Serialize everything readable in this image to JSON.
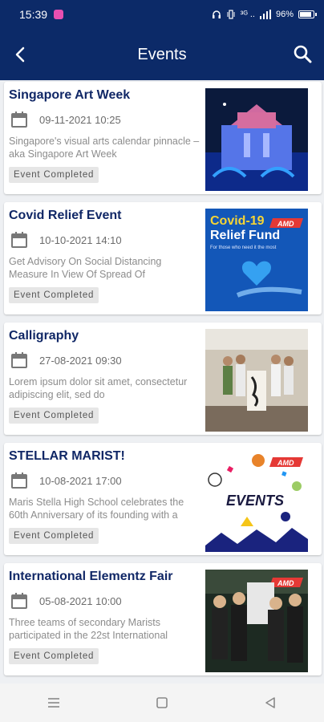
{
  "status_bar": {
    "time": "15:39",
    "network": "³ᴳ ..",
    "battery": "96%",
    "battery_level": 0.96
  },
  "header": {
    "title": "Events",
    "back_icon": "back-arrow-icon",
    "search_icon": "search-icon"
  },
  "events": [
    {
      "title": "Singapore Art Week",
      "date": "09-11-2021 10:25",
      "description": "Singapore's visual arts calendar pinnacle – aka Singapore Art Week",
      "status": "Event Completed",
      "thumb": "building-lights"
    },
    {
      "title": "Covid Relief Event",
      "date": "10-10-2021 14:10",
      "description": "Get Advisory On Social Distancing Measure In View Of Spread Of",
      "status": "Event Completed",
      "thumb": "covid-fund",
      "thumb_text": {
        "title": "Covid-19\nRelief Fund",
        "sub": "For those who need it the most",
        "brand": "AMD"
      }
    },
    {
      "title": "Calligraphy",
      "date": "27-08-2021 09:30",
      "description": "Lorem ipsum dolor sit amet, consectetur adipiscing elit, sed do",
      "status": "Event Completed",
      "thumb": "group-photo"
    },
    {
      "title": "STELLAR MARIST!",
      "date": "10-08-2021 17:00",
      "description": "Maris Stella High School celebrates the 60th Anniversary of its founding with a",
      "status": "Event Completed",
      "thumb": "events-poster",
      "thumb_text": {
        "title": "EVENTS",
        "brand": "AMD"
      }
    },
    {
      "title": "International Elementz Fair",
      "date": "05-08-2021 10:00",
      "description": "Three teams of secondary Marists participated in the 22st International",
      "status": "Event Completed",
      "thumb": "students",
      "thumb_text": {
        "brand": "AMD"
      }
    }
  ],
  "nav": {
    "menu_icon": "menu-icon",
    "home_icon": "home-square-icon",
    "back_icon": "back-triangle-icon"
  },
  "colors": {
    "primary": "#0c2a68",
    "title": "#102766",
    "badge": "#e6e6e6"
  }
}
